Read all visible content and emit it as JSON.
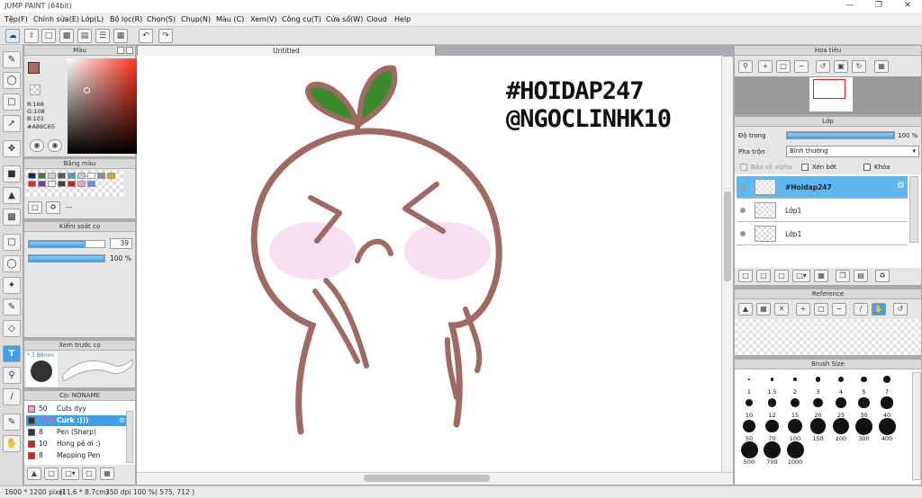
{
  "window": {
    "title": "JUMP PAINT (64bit)"
  },
  "menu": [
    "Tệp(F)",
    "Chỉnh sửa(E)",
    "Lớp(L)",
    "Bộ lọc(R)",
    "Chọn(S)",
    "Chụp(N)",
    "Màu (C)",
    "Xem(V)",
    "Công cụ(T)",
    "Cửa sổ(W)",
    "Cloud",
    "Help"
  ],
  "canvas": {
    "tab_title": "Untitled",
    "text_line1": "#HOIDAP247",
    "text_line2": "@NGOCLINHK10"
  },
  "color_panel": {
    "title": "Màu",
    "r": "R:168",
    "g": "G:108",
    "b": "B:101",
    "hex": "#A86C65",
    "main_color": "#a86c65"
  },
  "palette_panel": {
    "title": "Bảng màu",
    "dash": "---",
    "swatches": [
      "#1e1e6e",
      "#3a7a3a",
      "#d0d0d0",
      "#5a5a5a",
      "#4a9ae0",
      "#a8d8f0",
      "#ffffff",
      "#8c8c8c",
      "#e0a020",
      "#d03030",
      "#7040a0",
      "#f0f0f0",
      "#404040",
      "#c02020",
      "#f0a0d0",
      "#6090f0"
    ]
  },
  "brush_control": {
    "title": "Kiểm soát cọ",
    "size_value": "39",
    "size_fraction": 0.75,
    "opacity_label": "100 %",
    "opacity_fraction": 1.0
  },
  "brush_preview": {
    "title": "Xem trước cọ",
    "size_text": "* 3.88mm"
  },
  "brush_list": {
    "title": "Cọ: NONAME",
    "items": [
      {
        "size": "50",
        "name": "Cuts dyy",
        "color": "#f2a0e0",
        "selected": false
      },
      {
        "size": "11.6",
        "name": "Curk :)))",
        "color": "#333333",
        "selected": true
      },
      {
        "size": "8",
        "name": "Pen (Sharp)",
        "color": "#333333",
        "selected": false
      },
      {
        "size": "10",
        "name": "Hong pé ơi :)",
        "color": "#e02020",
        "selected": false
      },
      {
        "size": "8",
        "name": "Mapping Pen",
        "color": "#e02020",
        "selected": false
      }
    ]
  },
  "navigator": {
    "title": "Hoa tiêu"
  },
  "layer_panel": {
    "title": "Lớp",
    "opacity_label": "Độ trong",
    "opacity_value": "100 %",
    "opacity_fraction": 1.0,
    "blend_label": "Pha trộn",
    "blend_value": "Bình thường",
    "protect_alpha": "Bảo vệ alpha",
    "clipping": "Xén bớt",
    "lock": "Khóa",
    "layers": [
      {
        "name": "#Hoidap247",
        "selected": true
      },
      {
        "name": "Lớp1",
        "selected": false
      },
      {
        "name": "Lớp1",
        "selected": false
      }
    ]
  },
  "reference_panel": {
    "title": "Reference"
  },
  "brush_size_panel": {
    "title": "Brush Size",
    "sizes": [
      "1",
      "1.5",
      "2",
      "3",
      "4",
      "5",
      "7",
      "10",
      "12",
      "15",
      "20",
      "25",
      "30",
      "40",
      "50",
      "70",
      "100",
      "150",
      "200",
      "300",
      "400",
      "500",
      "700",
      "1000"
    ]
  },
  "status": {
    "dimensions": "1600 * 1200 pixel",
    "physical": "(11.6 * 8.7cm)",
    "dpi": "350 dpi",
    "zoom": "100 %",
    "cursor": "( 575, 712 )"
  }
}
